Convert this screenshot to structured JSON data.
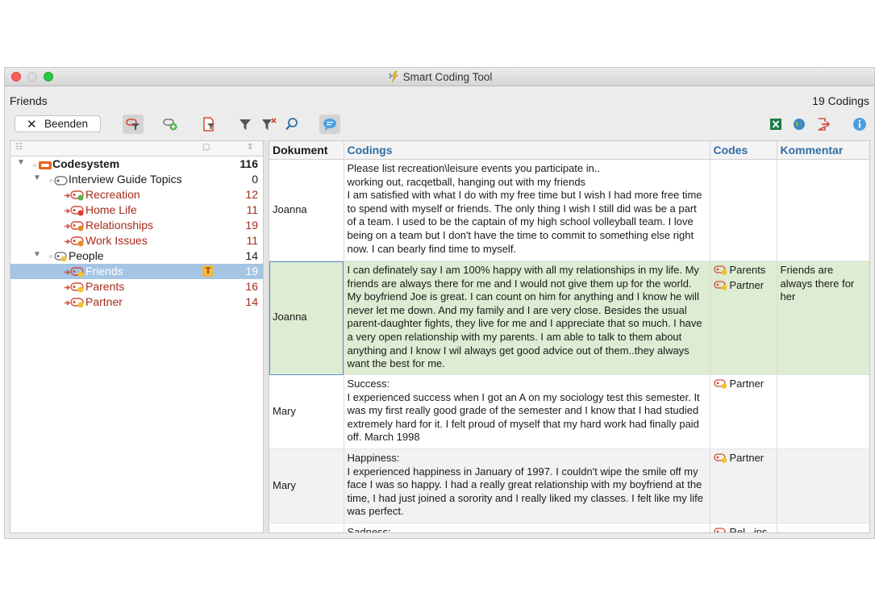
{
  "window": {
    "title": "Smart Coding Tool"
  },
  "header": {
    "left_label": "Friends",
    "codings_count": "19 Codings"
  },
  "toolbar": {
    "close_label": "Beenden"
  },
  "tree": {
    "root": {
      "label": "Codesystem",
      "count": "116"
    },
    "groups": [
      {
        "label": "Interview Guide Topics",
        "count": "0",
        "children": [
          {
            "label": "Recreation",
            "count": "12",
            "color": "#5bb24b"
          },
          {
            "label": "Home Life",
            "count": "11",
            "color": "#e03c2d"
          },
          {
            "label": "Relationships",
            "count": "19",
            "color": "#e8882b"
          },
          {
            "label": "Work Issues",
            "count": "11",
            "color": "#e8882b"
          }
        ]
      },
      {
        "label": "People",
        "count": "14",
        "children": [
          {
            "label": "Friends",
            "count": "19",
            "color": "#f3c22f",
            "selected": true,
            "badge": "T"
          },
          {
            "label": "Parents",
            "count": "16",
            "color": "#f3c22f"
          },
          {
            "label": "Partner",
            "count": "14",
            "color": "#f3c22f"
          }
        ]
      }
    ]
  },
  "table": {
    "columns": [
      "Dokument",
      "Codings",
      "Codes",
      "Kommentar"
    ],
    "rows": [
      {
        "document": "Joanna",
        "coding": "Please list recreation\\leisure events you participate in..\nworking out, racqetball, hanging out with my friends\nI am satisfied with what I do with my free time but I wish I had more free time to spend with myself or friends.  The only thing I wish I still did was be a part of a team.  I used to be the captain of my high school volleyball team.  I love being on a team but I don't have the time to commit to something else right now.  I can bearly find time to myself.",
        "codes": [],
        "comment": ""
      },
      {
        "document": "Joanna",
        "coding": "I can definately say I am 100% happy with all my relationships in my life.  My friends are always there for me and I would not give them up for the world.  My boyfriend Joe is great.  I can count on him for anything and I know he will never let me down.  And my family and I are very close.  Besides the usual parent-daughter fights, they live for me and I appreciate that so much.  I have a very open relationship with my parents.  I am able to talk to them about anything and I know I wil always get good advice out of them..they always want the best for me.",
        "codes": [
          "Parents",
          "Partner"
        ],
        "comment": "Friends are always there for her"
      },
      {
        "document": "Mary",
        "coding": "Success:\nI experienced success when I got an A on my sociology test this semester. It was my first really good grade of the semester and I know that I had studied extremely hard for it. I felt proud of myself that my hard work had finally paid off. March 1998",
        "codes": [
          "Partner"
        ],
        "comment": ""
      },
      {
        "document": "Mary",
        "coding": "Happiness:\nI experienced happiness in January of 1997. I couldn't wipe the smile off my face I was so happy. I had a really great relationship with my boyfriend at the time, I had just joined a sorority and I really liked my classes. I felt like my life was perfect.",
        "codes": [
          "Partner"
        ],
        "comment": ""
      },
      {
        "document": "",
        "coding": "Sadness:",
        "codes": [
          "Rel...ips"
        ],
        "comment": ""
      }
    ]
  },
  "colors": {
    "accent": "#2f6ea5",
    "code_text": "#a62a1a",
    "selection": "#a5c5e4",
    "highlight_row": "#ddecd2"
  },
  "icons": [
    "filter-codes-icon",
    "new-code-icon",
    "document-filter-icon",
    "filter-icon",
    "clear-filter-icon",
    "search-icon",
    "comment-icon",
    "excel-export-icon",
    "web-export-icon",
    "export-icon",
    "info-icon"
  ]
}
